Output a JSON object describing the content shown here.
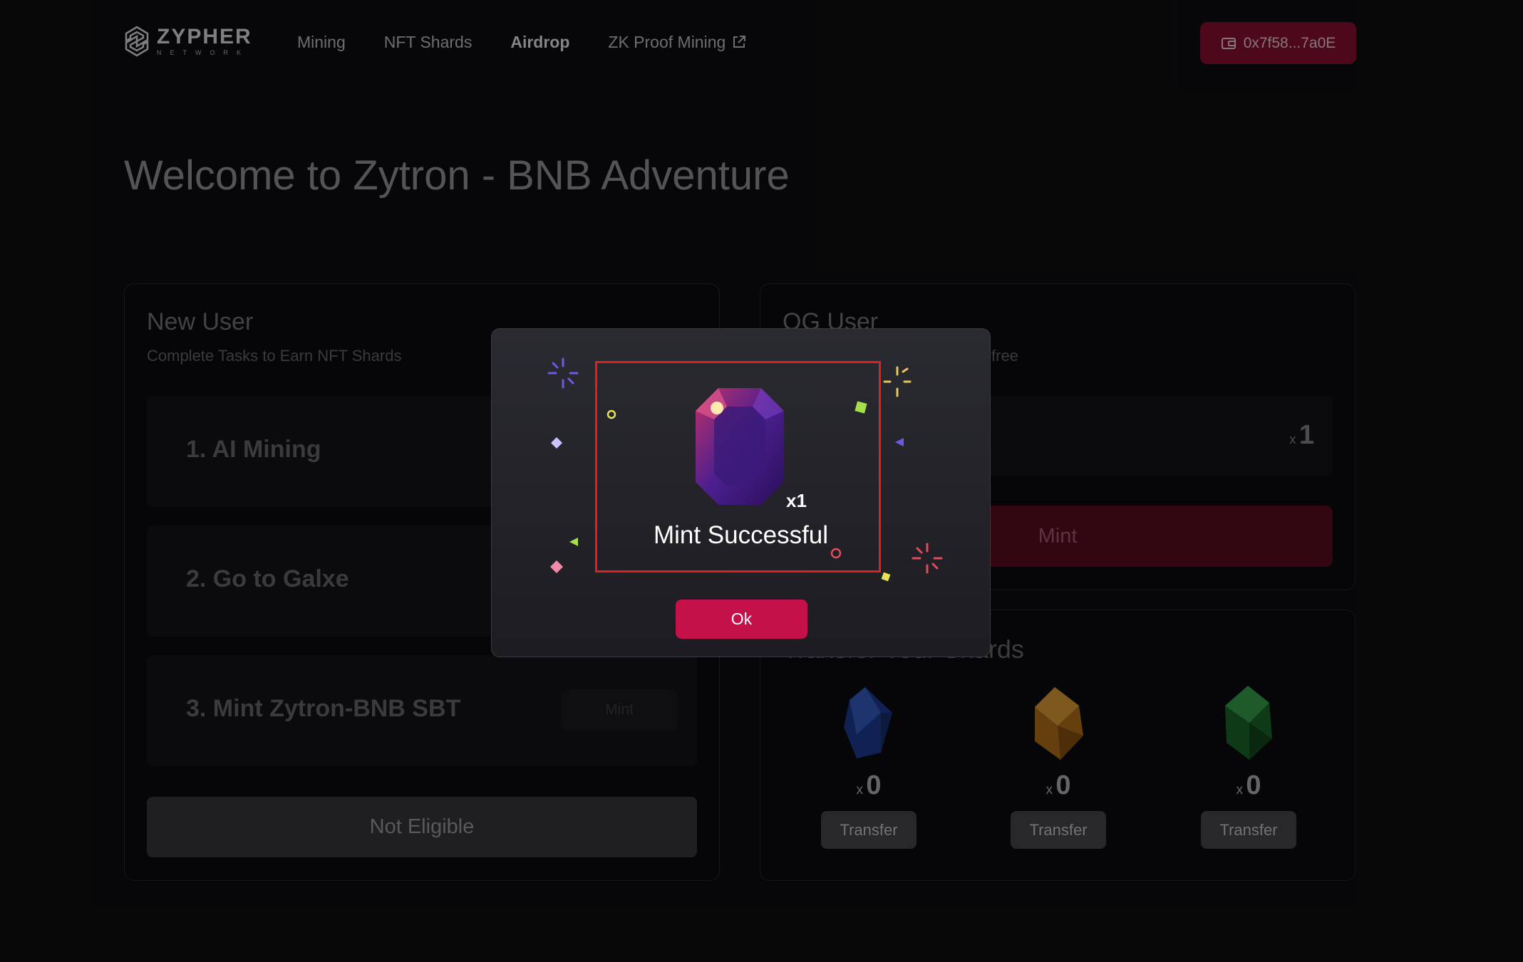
{
  "header": {
    "logo_name": "ZYPHER",
    "logo_sub": "NETWORK",
    "nav": [
      {
        "label": "Mining"
      },
      {
        "label": "NFT Shards"
      },
      {
        "label": "Airdrop"
      },
      {
        "label": "ZK Proof Mining"
      }
    ],
    "active_nav": "Airdrop",
    "wallet": "0x7f58...7a0E"
  },
  "page_title": "Welcome to Zytron - BNB Adventure",
  "new_user": {
    "title": "New User",
    "subtitle": "Complete Tasks to Earn NFT Shards",
    "tasks": [
      {
        "label": "1. AI Mining"
      },
      {
        "label": "2. Go to Galxe"
      },
      {
        "label": "3. Mint Zytron-BNB SBT",
        "action": "Mint"
      }
    ],
    "status_button": "Not Eligible"
  },
  "og_user": {
    "title": "OG User",
    "subtitle_visible": "free",
    "qty_prefix": "x",
    "qty": "1",
    "mint_button": "Mint"
  },
  "transfer": {
    "title_visible": "Transfer Your Shards",
    "shards": [
      {
        "color": "blue",
        "prefix": "x",
        "count": "0",
        "button": "Transfer"
      },
      {
        "color": "orange",
        "prefix": "x",
        "count": "0",
        "button": "Transfer"
      },
      {
        "color": "green",
        "prefix": "x",
        "count": "0",
        "button": "Transfer"
      }
    ]
  },
  "modal": {
    "gem_qty": "x1",
    "message": "Mint Successful",
    "ok_button": "Ok"
  },
  "colors": {
    "accent": "#c4114a",
    "wallet_bg": "#8c0f33",
    "highlight": "#e02020",
    "background": "#0e0e11"
  }
}
